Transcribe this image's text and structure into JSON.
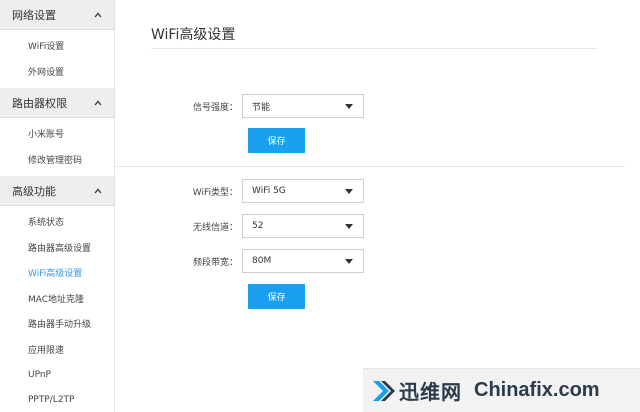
{
  "sidebar": {
    "groups": [
      {
        "label": "网络设置",
        "items": [
          "WiFi设置",
          "外网设置"
        ]
      },
      {
        "label": "路由器权限",
        "items": [
          "小米账号",
          "修改管理密码"
        ]
      },
      {
        "label": "高级功能",
        "items": [
          "系统状态",
          "路由器高级设置",
          "WiFi高级设置",
          "MAC地址克隆",
          "路由器手动升级",
          "应用限速",
          "UPnP",
          "PPTP/L2TP"
        ]
      }
    ],
    "active_item": "WiFi高级设置"
  },
  "main": {
    "title": "WiFi高级设置",
    "section1": {
      "signal_label": "信号强度：",
      "signal_value": "节能",
      "save_label": "保存"
    },
    "section2": {
      "wifi_type_label": "WiFi类型：",
      "wifi_type_value": "WiFi 5G",
      "channel_label": "无线信道：",
      "channel_value": "52",
      "bandwidth_label": "频段带宽：",
      "bandwidth_value": "80M",
      "save_label": "保存"
    }
  },
  "watermark": {
    "cn": "迅维网",
    "en": "Chinafix.com"
  },
  "colors": {
    "accent": "#1aa0ee",
    "active_text": "#3399e6",
    "sidebar_header_bg": "#eeeeee"
  }
}
